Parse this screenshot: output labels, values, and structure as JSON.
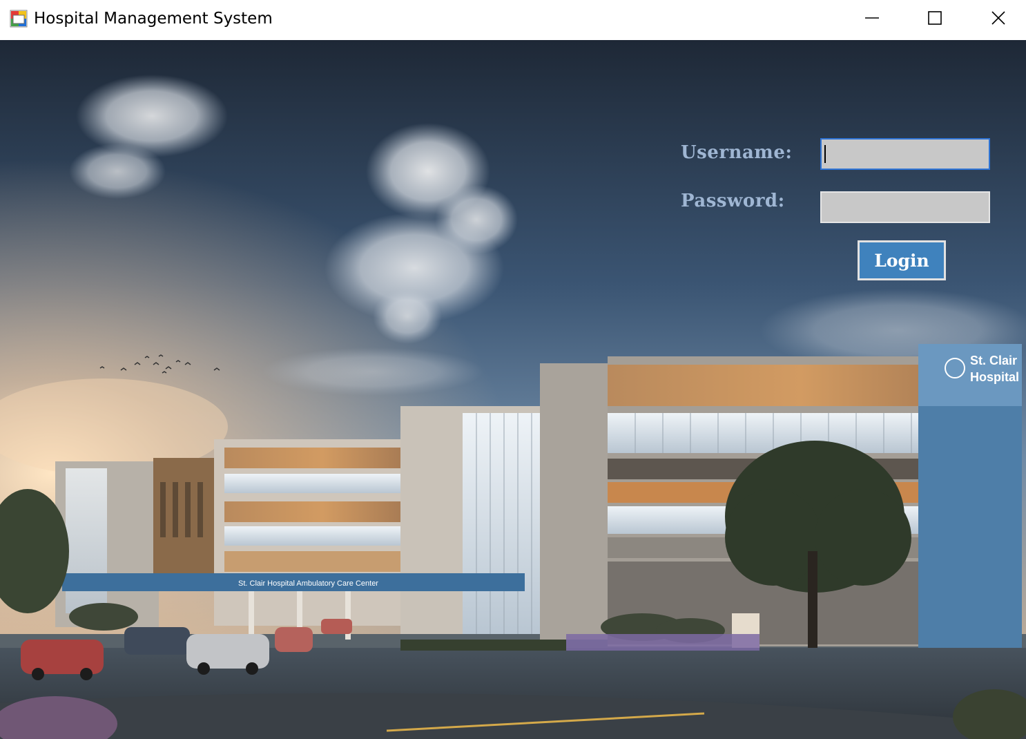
{
  "window": {
    "title": "Hospital Management System",
    "icon": "app-window-icon",
    "controls": [
      "minimize-icon",
      "maximize-icon",
      "close-icon"
    ]
  },
  "login": {
    "username_label": "Username:",
    "password_label": "Password:",
    "username_value": "",
    "password_value": "",
    "login_label": "Login",
    "accent": "#3f82bd",
    "label_color": "#9fb6d3"
  },
  "background": {
    "building_sign": [
      "St. Clair",
      "Hospital"
    ],
    "canopy_sign": "St. Clair Hospital Ambulatory Care Center"
  }
}
